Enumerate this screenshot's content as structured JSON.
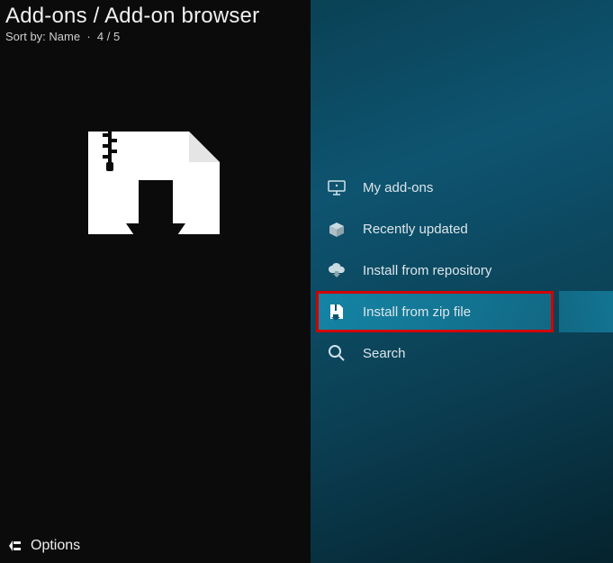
{
  "header": {
    "title": "Add-ons / Add-on browser",
    "sort_label": "Sort by: Name",
    "position": "4 / 5"
  },
  "menu": {
    "items": [
      {
        "label": "My add-ons"
      },
      {
        "label": "Recently updated"
      },
      {
        "label": "Install from repository"
      },
      {
        "label": "Install from zip file"
      },
      {
        "label": "Search"
      }
    ],
    "selected_index": 3
  },
  "footer": {
    "options_label": "Options"
  },
  "colors": {
    "highlight": "#1cb2da",
    "highlight_border": "#d30000"
  }
}
